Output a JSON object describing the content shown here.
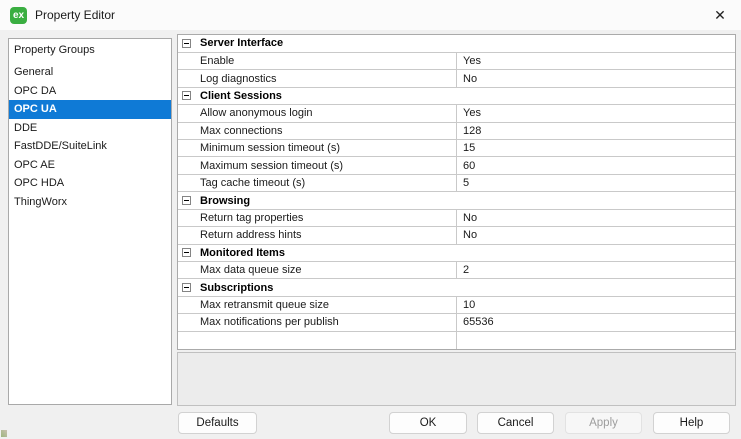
{
  "window": {
    "title": "Property Editor",
    "icon_label": "ex",
    "close_glyph": "✕"
  },
  "sidebar": {
    "header": "Property Groups",
    "items": [
      {
        "label": "General"
      },
      {
        "label": "OPC DA"
      },
      {
        "label": "OPC UA",
        "selected": true
      },
      {
        "label": "DDE"
      },
      {
        "label": "FastDDE/SuiteLink"
      },
      {
        "label": "OPC AE"
      },
      {
        "label": "OPC HDA"
      },
      {
        "label": "ThingWorx"
      }
    ]
  },
  "grid": {
    "rows": [
      {
        "type": "category",
        "label": "Server Interface"
      },
      {
        "type": "property",
        "label": "Enable",
        "value": "Yes"
      },
      {
        "type": "property",
        "label": "Log diagnostics",
        "value": "No"
      },
      {
        "type": "category",
        "label": "Client Sessions"
      },
      {
        "type": "property",
        "label": "Allow anonymous login",
        "value": "Yes"
      },
      {
        "type": "property",
        "label": "Max connections",
        "value": "128"
      },
      {
        "type": "property",
        "label": "Minimum session timeout (s)",
        "value": "15"
      },
      {
        "type": "property",
        "label": "Maximum session timeout (s)",
        "value": "60"
      },
      {
        "type": "property",
        "label": "Tag cache timeout (s)",
        "value": "5"
      },
      {
        "type": "category",
        "label": "Browsing"
      },
      {
        "type": "property",
        "label": "Return tag properties",
        "value": "No"
      },
      {
        "type": "property",
        "label": "Return address hints",
        "value": "No"
      },
      {
        "type": "category",
        "label": "Monitored Items"
      },
      {
        "type": "property",
        "label": "Max data queue size",
        "value": "2"
      },
      {
        "type": "category",
        "label": "Subscriptions"
      },
      {
        "type": "property",
        "label": "Max retransmit queue size",
        "value": "10"
      },
      {
        "type": "property",
        "label": "Max notifications per publish",
        "value": "65536"
      },
      {
        "type": "empty",
        "label": "",
        "value": ""
      }
    ]
  },
  "buttons": {
    "defaults": "Defaults",
    "ok": "OK",
    "cancel": "Cancel",
    "apply": "Apply",
    "help": "Help"
  },
  "colors": {
    "selection": "#0f7ad6",
    "icon-green": "#3aae41",
    "grid-line": "#c9c9c9",
    "disabled-text": "#9d9d9d"
  }
}
